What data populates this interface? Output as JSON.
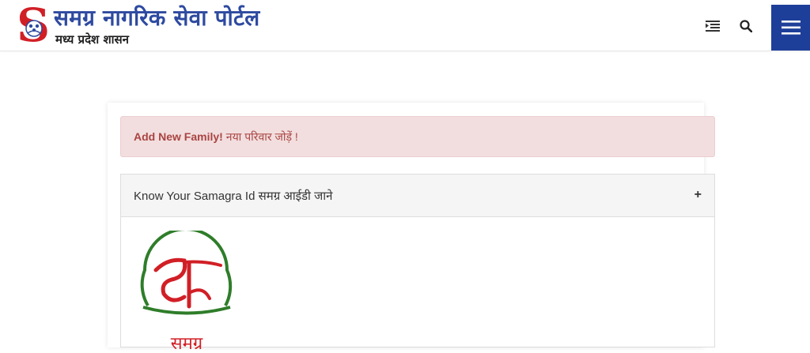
{
  "header": {
    "title": "समग्र नागरिक सेवा पोर्टल",
    "subtitle": "मध्य प्रदेश शासन",
    "logo_letter": "S",
    "icons": [
      "indent-list-icon",
      "search-icon",
      "hamburger-menu-icon"
    ]
  },
  "alert": {
    "strong": "Add New Family!",
    "text": "नया परिवार जोड़ें !"
  },
  "panel": {
    "title": "Know Your Samagra Id समग्र आईडी जाने",
    "toggle": "+",
    "logo_caption": "समग्र"
  },
  "colors": {
    "brand_blue": "#2e4aa0",
    "menu_bg": "#1e3f99",
    "alert_bg": "#f2dede",
    "alert_text": "#a94442",
    "logo_red": "#d11f26",
    "logo_green": "#2f7d2a"
  }
}
